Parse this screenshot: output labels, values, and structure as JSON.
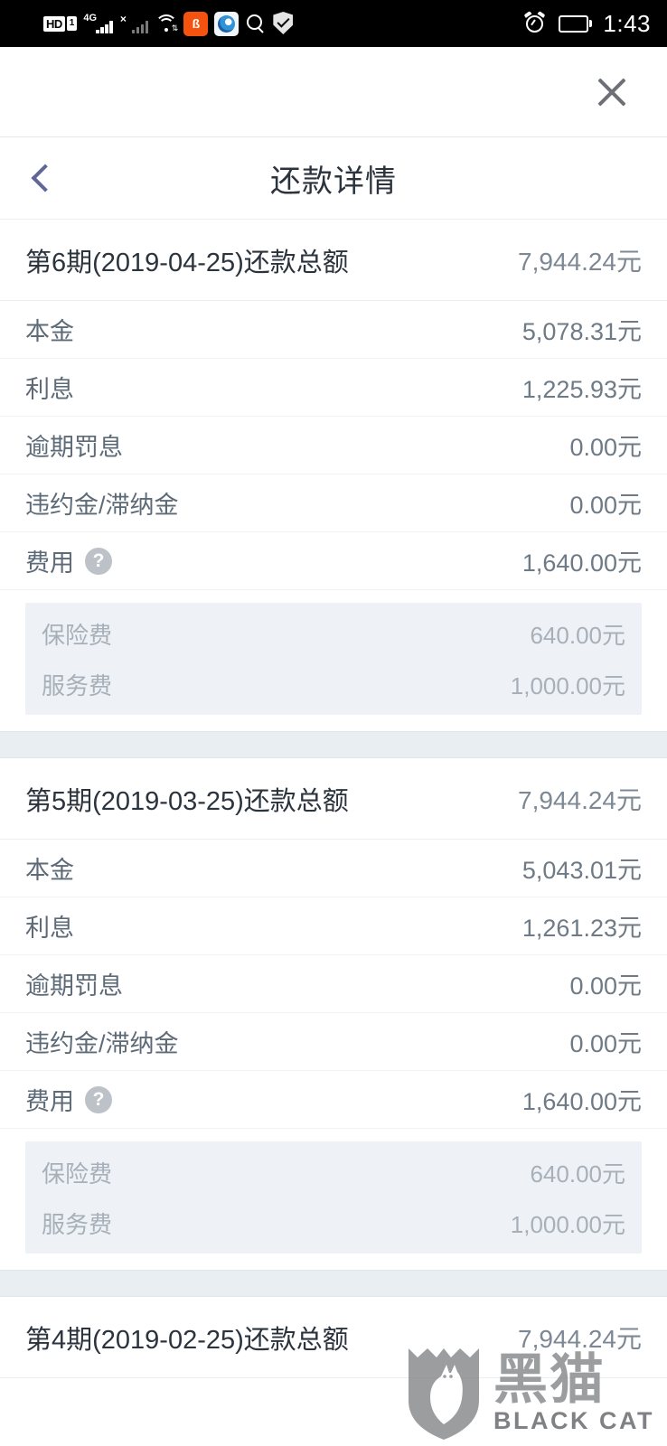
{
  "status_bar": {
    "hd_label": "HD",
    "sim_label": "1",
    "network_label": "4G",
    "no_service_mark": "×",
    "icons": [
      "hd-icon",
      "sim-icon",
      "signal-4g-icon",
      "signal-no-service-icon",
      "wifi-icon",
      "app-orange-icon",
      "app-blue-icon",
      "search-icon",
      "shield-check-icon"
    ],
    "app_orange_glyph": "ß",
    "alarm_icon": "alarm-icon",
    "battery_icon": "battery-icon",
    "time": "1:43"
  },
  "window": {
    "close_label": "×"
  },
  "header": {
    "back_label": "‹",
    "title": "还款详情"
  },
  "labels": {
    "principal": "本金",
    "interest": "利息",
    "overdue_penalty": "逾期罚息",
    "liquidated_damages": "违约金/滞纳金",
    "fees": "费用",
    "help": "?",
    "insurance_fee": "保险费",
    "service_fee": "服务费"
  },
  "sections": [
    {
      "title": "第6期(2019-04-25)还款总额",
      "total": "7,944.24元",
      "rows": [
        {
          "label": "本金",
          "value": "5,078.31元"
        },
        {
          "label": "利息",
          "value": "1,225.93元"
        },
        {
          "label": "逾期罚息",
          "value": "0.00元"
        },
        {
          "label": "违约金/滞纳金",
          "value": "0.00元"
        },
        {
          "label": "费用",
          "value": "1,640.00元",
          "has_help": true
        }
      ],
      "subfees": [
        {
          "label": "保险费",
          "value": "640.00元"
        },
        {
          "label": "服务费",
          "value": "1,000.00元"
        }
      ]
    },
    {
      "title": "第5期(2019-03-25)还款总额",
      "total": "7,944.24元",
      "rows": [
        {
          "label": "本金",
          "value": "5,043.01元"
        },
        {
          "label": "利息",
          "value": "1,261.23元"
        },
        {
          "label": "逾期罚息",
          "value": "0.00元"
        },
        {
          "label": "违约金/滞纳金",
          "value": "0.00元"
        },
        {
          "label": "费用",
          "value": "1,640.00元",
          "has_help": true
        }
      ],
      "subfees": [
        {
          "label": "保险费",
          "value": "640.00元"
        },
        {
          "label": "服务费",
          "value": "1,000.00元"
        }
      ]
    },
    {
      "title": "第4期(2019-02-25)还款总额",
      "total": "7,944.24元",
      "rows": [],
      "subfees": []
    }
  ],
  "watermark": {
    "cn": "黑猫",
    "en": "BLACK CAT"
  },
  "colors": {
    "accent_back": "#5f6796",
    "title_text": "#2b333d",
    "label_text": "#5d6a77",
    "value_text": "#6e7a86",
    "sub_text": "#a7b0b9",
    "subfee_bg": "#eef2f6",
    "section_gap_bg": "#e9eef3",
    "status_bar_bg": "#000000"
  }
}
